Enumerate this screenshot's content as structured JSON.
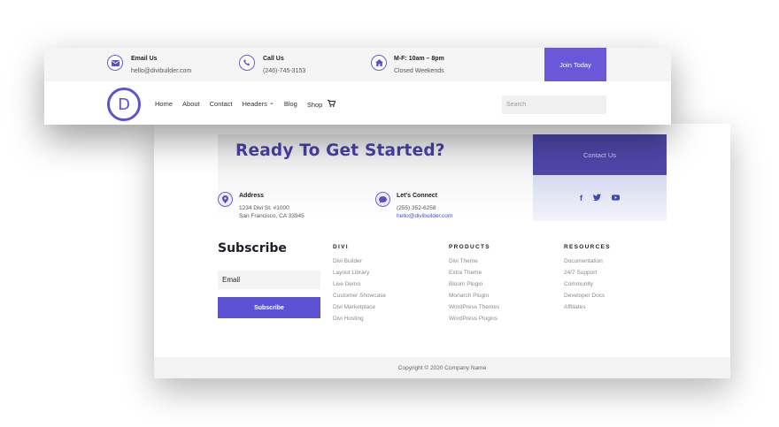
{
  "header": {
    "topbar": {
      "email": {
        "title": "Email Us",
        "value": "hello@divibuilder.com",
        "icon": "envelope-icon"
      },
      "call": {
        "title": "Call Us",
        "value": "(246)-745-3153",
        "icon": "phone-icon"
      },
      "hours": {
        "title": "M-F: 10am – 8pm",
        "value": "Closed Weekends",
        "icon": "home-icon"
      },
      "join_label": "Join Today"
    },
    "logo_letter": "D",
    "nav": [
      "Home",
      "About",
      "Contact",
      "Headers",
      "Blog",
      "Shop"
    ],
    "headers_chevron": "⌄",
    "cart_icon": "cart-icon",
    "search_placeholder": "Search"
  },
  "footer": {
    "cta": {
      "title": "Ready To Get Started?",
      "button": "Contact Us"
    },
    "address": {
      "title": "Address",
      "line1": "1234 Divi St. #1000",
      "line2": "San Francisco, CA 33945",
      "icon": "map-pin-icon"
    },
    "connect": {
      "title": "Let's Connect",
      "phone": "(255) 352-6258",
      "email": "hello@divibuilder.com",
      "icon": "chat-icon"
    },
    "social": [
      "facebook-icon",
      "twitter-icon",
      "youtube-icon"
    ],
    "subscribe": {
      "title": "Subscribe",
      "email_value": "Email",
      "button": "Subscribe"
    },
    "columns": [
      {
        "heading": "DIVI",
        "links": [
          "Divi Builder",
          "Layout Library",
          "Live Demo",
          "Customer Showcase",
          "Divi Marketplace",
          "Divi Hosting"
        ]
      },
      {
        "heading": "PRODUCTS",
        "links": [
          "Divi Theme",
          "Extra Theme",
          "Bloom Plugin",
          "Monarch Plugin",
          "WordPress Themes",
          "WordPress Plugins"
        ]
      },
      {
        "heading": "RESOURCES",
        "links": [
          "Documentation",
          "24/7 Support",
          "Community",
          "Developer Docs",
          "Affiliates"
        ]
      }
    ],
    "copyright": "Copyright © 2020 Company Name"
  },
  "colors": {
    "accent": "#5e52d4",
    "cta_dark": "#4f46a8",
    "title_purple": "#4a3fa8",
    "link_blue": "#3f4fd0"
  }
}
